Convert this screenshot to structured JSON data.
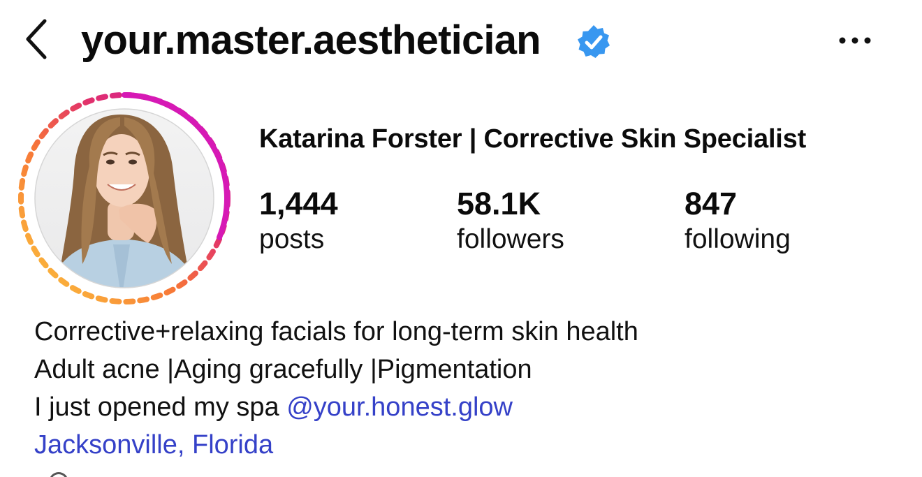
{
  "header": {
    "username": "your.master.aesthetician",
    "back_icon": "chevron-left-icon",
    "verified_icon": "verified-badge-icon",
    "more_icon": "ellipsis-icon",
    "verified_color": "#3897F0"
  },
  "profile": {
    "display_name": "Katarina Forster | Corrective Skin Specialist",
    "story_ring_colors": [
      "#E1306C",
      "#C913B9",
      "#F56040",
      "#F77737",
      "#FCAF45",
      "#FFDC80"
    ]
  },
  "stats": {
    "posts": {
      "value": "1,444",
      "label": "posts"
    },
    "followers": {
      "value": "58.1K",
      "label": "followers"
    },
    "following": {
      "value": "847",
      "label": "following"
    }
  },
  "bio": {
    "line1": "Corrective+relaxing facials for long-term skin health",
    "line2": "Adult acne |Aging gracefully |Pigmentation",
    "line3_text": "I just opened my spa ",
    "line3_mention": "@your.honest.glow",
    "location": "Jacksonville, Florida",
    "link_color": "#3541C8"
  }
}
